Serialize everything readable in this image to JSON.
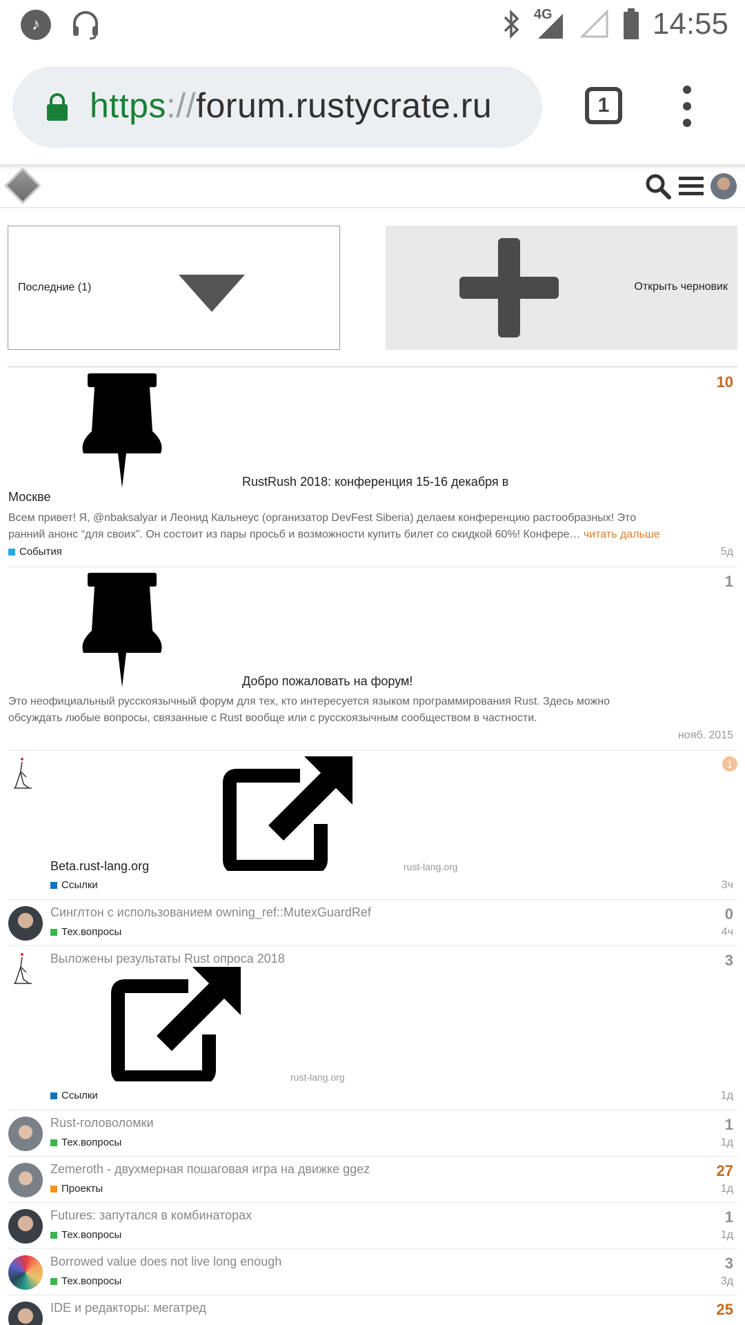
{
  "status_bar": {
    "time": "14:55",
    "network": "4G",
    "left_icons": [
      "music-icon",
      "headset-icon"
    ],
    "right_icons": [
      "bluetooth-icon",
      "signal-icon",
      "signal-empty-icon",
      "battery-icon"
    ]
  },
  "browser": {
    "url_scheme": "https",
    "url_sep": "://",
    "url_host": "forum.rustycrate.ru",
    "tab_count": "1"
  },
  "nav": {
    "dropdown_label": "Последние (1)",
    "draft_label": "Открыть черновик"
  },
  "colors": {
    "events": "#25aae1",
    "links": "#0e76bd",
    "tech": "#3ab54a",
    "projects": "#f7941d",
    "hot": "#c4691e"
  },
  "topics": [
    {
      "title_line1": "RustRush 2018: конференция 15-16 декабря в",
      "title_line2": "Москве",
      "excerpt_line1": "Всем привет! Я, @nbaksalyar и Леонид Кальнеус (организатор DevFest Siberia) делаем конференцию растообразных! Это",
      "excerpt_line2": "ранний анонс “для своих”. Он состоит из пары просьб и возможности купить билет со скидкой 60%! Конфере…",
      "read_more": "читать дальше",
      "category": "События",
      "posts": "10",
      "age": "5д"
    },
    {
      "title": "Добро пожаловать на форум!",
      "excerpt_line1": "Это неофициальный русскоязычный форум для тех, кто интересуется языком программирования Rust. Здесь можно",
      "excerpt_line2": "обсуждать любые вопросы, связанные с Rust вообще или с русскоязычным сообществом в частности.",
      "age": "нояб. 2015",
      "posts": "1"
    },
    {
      "title": "Beta.rust-lang.org",
      "domain": "rust-lang.org",
      "category": "Ссылки",
      "badge": "1",
      "age": "3ч"
    },
    {
      "title": "Синглтон с использованием owning_ref::MutexGuardRef",
      "category": "Тех.вопросы",
      "posts": "0",
      "age": "4ч"
    },
    {
      "title": "Выложены результаты Rust опроса 2018",
      "domain": "rust-lang.org",
      "category": "Ссылки",
      "posts": "3",
      "age": "1д"
    },
    {
      "title": "Rust-головоломки",
      "category": "Тех.вопросы",
      "posts": "1",
      "age": "1д"
    },
    {
      "title": "Zemeroth - двухмерная пошаговая игра на движке ggez",
      "category": "Проекты",
      "posts": "27",
      "age": "1д"
    },
    {
      "title": "Futures: запутался в комбинаторах",
      "category": "Тех.вопросы",
      "posts": "1",
      "age": "1д"
    },
    {
      "title": "Borrowed value does not live long enough",
      "category": "Тех.вопросы",
      "posts": "3",
      "age": "3д"
    },
    {
      "title": "IDE и редакторы: мегатред",
      "posts": "25"
    }
  ]
}
